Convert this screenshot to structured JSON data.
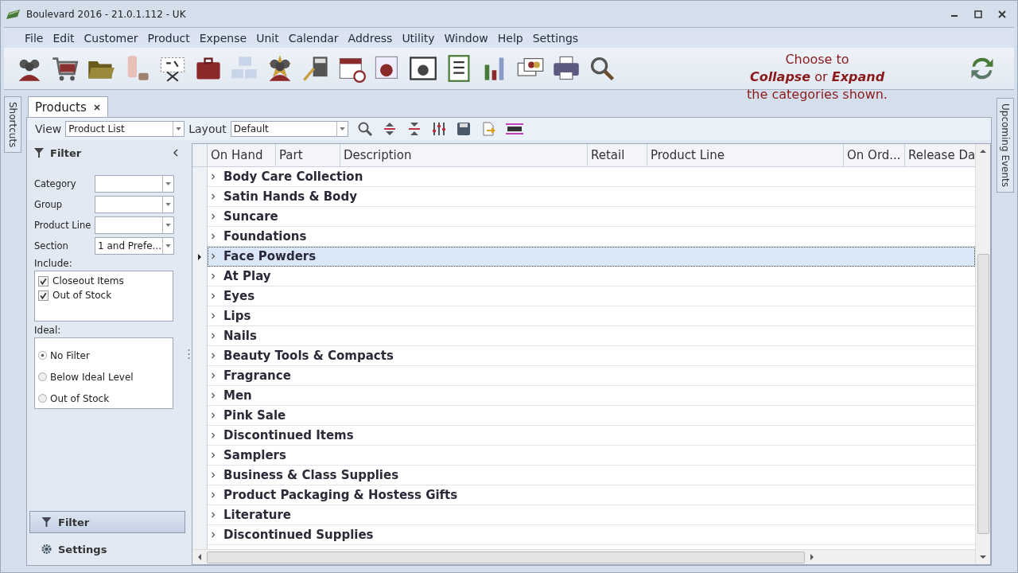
{
  "window": {
    "title": "Boulevard 2016 - 21.0.1.112  -  UK"
  },
  "menu": [
    "File",
    "Edit",
    "Customer",
    "Product",
    "Expense",
    "Unit",
    "Calendar",
    "Address",
    "Utility",
    "Window",
    "Help",
    "Settings"
  ],
  "hint": [
    "Choose to",
    "**Collapse** or **Expand**",
    "the categories shown."
  ],
  "side_tabs": {
    "left": "Shortcuts",
    "right": "Upcoming Events"
  },
  "tabs": [
    {
      "label": "Products",
      "selected": true
    }
  ],
  "view_bar": {
    "view_label": "View",
    "view_value": "Product List",
    "layout_label": "Layout",
    "layout_value": "Default"
  },
  "filter": {
    "title": "Filter",
    "fields": [
      {
        "label": "Category"
      },
      {
        "label": "Group"
      },
      {
        "label": "Product Line"
      },
      {
        "label": "Section",
        "value": "1 and Prefe..."
      }
    ],
    "include_label": "Include:",
    "include": [
      {
        "label": "Closeout Items",
        "checked": true
      },
      {
        "label": "Out of Stock",
        "checked": true
      }
    ],
    "ideal_label": "Ideal:",
    "ideal": [
      {
        "label": "No Filter",
        "selected": true
      },
      {
        "label": "Below Ideal Level",
        "selected": false
      },
      {
        "label": "Out of Stock",
        "selected": false
      }
    ]
  },
  "nav": [
    {
      "label": "Filter",
      "kind": "filter",
      "selected": true
    },
    {
      "label": "Settings",
      "kind": "settings",
      "selected": false
    }
  ],
  "table": {
    "columns": [
      "On Hand",
      "Part",
      "Description",
      "Retail",
      "Product Line",
      "On Ord...",
      "Release Da"
    ],
    "rows": [
      {
        "label": "Body Care Collection",
        "selected": false
      },
      {
        "label": "Satin Hands & Body",
        "selected": false
      },
      {
        "label": "Suncare",
        "selected": false
      },
      {
        "label": "Foundations",
        "selected": false
      },
      {
        "label": "Face Powders",
        "selected": true
      },
      {
        "label": "At Play",
        "selected": false
      },
      {
        "label": "Eyes",
        "selected": false
      },
      {
        "label": "Lips",
        "selected": false
      },
      {
        "label": "Nails",
        "selected": false
      },
      {
        "label": "Beauty Tools & Compacts",
        "selected": false
      },
      {
        "label": "Fragrance",
        "selected": false
      },
      {
        "label": "Men",
        "selected": false
      },
      {
        "label": "Pink Sale",
        "selected": false
      },
      {
        "label": "Discontinued Items",
        "selected": false
      },
      {
        "label": "Samplers",
        "selected": false
      },
      {
        "label": "Business & Class Supplies",
        "selected": false
      },
      {
        "label": "Product Packaging & Hostess Gifts",
        "selected": false
      },
      {
        "label": "Literature",
        "selected": false
      },
      {
        "label": "Discontinued Supplies",
        "selected": false
      }
    ]
  }
}
